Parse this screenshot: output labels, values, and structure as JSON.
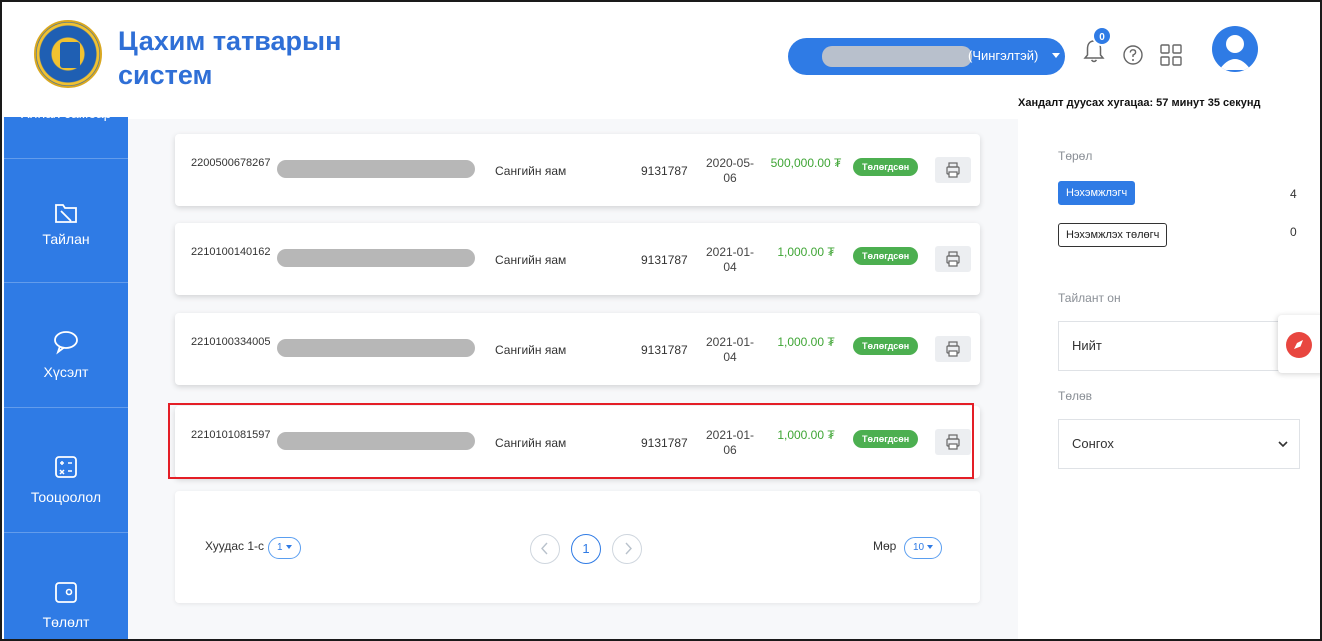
{
  "header": {
    "app_title": "Цахим татварын систем",
    "org_suffix": "(Чингэлтэй)",
    "notification_count": "0",
    "session_timer": "Хандалт дуусах хугацаа: 57 минут 35 секунд"
  },
  "sidebar": {
    "top_label": "Хянах самбар",
    "items": [
      {
        "label": "Тайлан",
        "icon": "report-folder-icon"
      },
      {
        "label": "Хүсэлт",
        "icon": "chat-bubble-icon"
      },
      {
        "label": "Тооцоолол",
        "icon": "calculator-icon"
      },
      {
        "label": "Төлөлт",
        "icon": "wallet-icon"
      }
    ]
  },
  "invoices": [
    {
      "id": "2200500678267",
      "org": "Сангийн яам",
      "code": "9131787",
      "date": "2020-05-06",
      "amount": "500,000.00 ₮",
      "status": "Төлөгдсөн"
    },
    {
      "id": "2210100140162",
      "org": "Сангийн яам",
      "code": "9131787",
      "date": "2021-01-04",
      "amount": "1,000.00 ₮",
      "status": "Төлөгдсөн"
    },
    {
      "id": "2210100334005",
      "org": "Сангийн яам",
      "code": "9131787",
      "date": "2021-01-04",
      "amount": "1,000.00 ₮",
      "status": "Төлөгдсөн"
    },
    {
      "id": "2210101081597",
      "org": "Сангийн яам",
      "code": "9131787",
      "date": "2021-01-06",
      "amount": "1,000.00 ₮",
      "status": "Төлөгдсөн"
    }
  ],
  "pager": {
    "page_label": "Хуудас 1-с",
    "page_select": "1",
    "current_page": "1",
    "rows_label": "Мөр",
    "rows_select": "10"
  },
  "filters": {
    "type_label": "Төрөл",
    "type_options": [
      {
        "label": "Нэхэмжлэгч",
        "count": "4",
        "active": true
      },
      {
        "label": "Нэхэмжлэх төлөгч",
        "count": "0",
        "active": false
      }
    ],
    "year_label": "Тайлант он",
    "year_value": "Нийт",
    "status_label": "Төлөв",
    "status_value": "Сонгох"
  },
  "colors": {
    "primary": "#2f7be5",
    "paid_badge": "#4caf50",
    "amount": "#3fa535",
    "highlight": "#e41e26"
  }
}
